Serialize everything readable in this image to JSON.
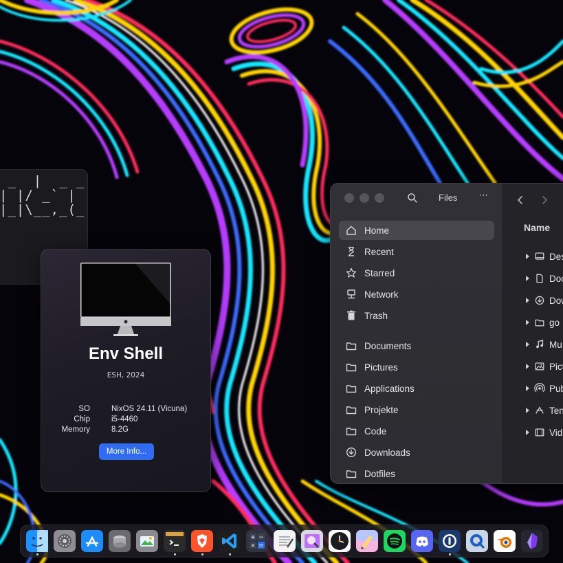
{
  "wallpaper": {
    "colors": [
      "#ff2a5c",
      "#ffd400",
      "#19e6ff",
      "#b63cff",
      "#3b6bff",
      "#ffffff"
    ]
  },
  "terminal": {
    "ascii_art": " _  |  _ _    \n| |/ _` | |  \n|_|\\__,_(_)  "
  },
  "about": {
    "title": "Env Shell",
    "subtitle": "ESH, 2024",
    "specs": [
      {
        "key": "SO",
        "value": "NixOS 24.11 (Vicuna)"
      },
      {
        "key": "Chip",
        "value": "i5-4460"
      },
      {
        "key": "Memory",
        "value": "8.2G"
      }
    ],
    "more_button": "More Info...",
    "accent": "#2f6cf1"
  },
  "files": {
    "title": "Files",
    "sidebar": [
      {
        "label": "Home",
        "icon": "home-icon",
        "active": true
      },
      {
        "label": "Recent",
        "icon": "clock-icon"
      },
      {
        "label": "Starred",
        "icon": "star-icon"
      },
      {
        "label": "Network",
        "icon": "network-icon"
      },
      {
        "label": "Trash",
        "icon": "trash-icon"
      },
      {
        "label": "Documents",
        "icon": "folder-icon"
      },
      {
        "label": "Pictures",
        "icon": "folder-icon"
      },
      {
        "label": "Applications",
        "icon": "folder-icon"
      },
      {
        "label": "Projekte",
        "icon": "folder-icon"
      },
      {
        "label": "Code",
        "icon": "folder-icon"
      },
      {
        "label": "Downloads",
        "icon": "download-icon"
      },
      {
        "label": "Dotfiles",
        "icon": "folder-icon"
      }
    ],
    "column_header": "Name",
    "rows": [
      {
        "label": "Des",
        "icon": "desktop-icon"
      },
      {
        "label": "Doc",
        "icon": "document-icon"
      },
      {
        "label": "Dow",
        "icon": "download-icon"
      },
      {
        "label": "go",
        "icon": "folder-icon"
      },
      {
        "label": "Mu",
        "icon": "music-icon"
      },
      {
        "label": "Pict",
        "icon": "image-icon"
      },
      {
        "label": "Pub",
        "icon": "share-icon"
      },
      {
        "label": "Ten",
        "icon": "template-icon"
      },
      {
        "label": "Vid",
        "icon": "video-icon"
      }
    ]
  },
  "dock": {
    "items": [
      {
        "name": "finder-icon",
        "running": true
      },
      {
        "name": "system-settings-icon",
        "running": false
      },
      {
        "name": "app-store-icon",
        "running": false
      },
      {
        "name": "disk-utility-icon",
        "running": false
      },
      {
        "name": "image-viewer-icon",
        "running": false
      },
      {
        "name": "terminal-icon",
        "running": true
      },
      {
        "name": "brave-browser-icon",
        "running": true
      },
      {
        "name": "vscode-icon",
        "running": true
      },
      {
        "name": "calculator-icon",
        "running": false
      },
      {
        "name": "text-editor-icon",
        "running": false
      },
      {
        "name": "preview-icon",
        "running": false
      },
      {
        "name": "clock-app-icon",
        "running": false
      },
      {
        "name": "paint-icon",
        "running": false
      },
      {
        "name": "spotify-icon",
        "running": false
      },
      {
        "name": "discord-icon",
        "running": false
      },
      {
        "name": "password-manager-icon",
        "running": true
      },
      {
        "name": "quicktime-icon",
        "running": false
      },
      {
        "name": "blender-icon",
        "running": false
      },
      {
        "name": "obsidian-icon",
        "running": false
      }
    ]
  }
}
